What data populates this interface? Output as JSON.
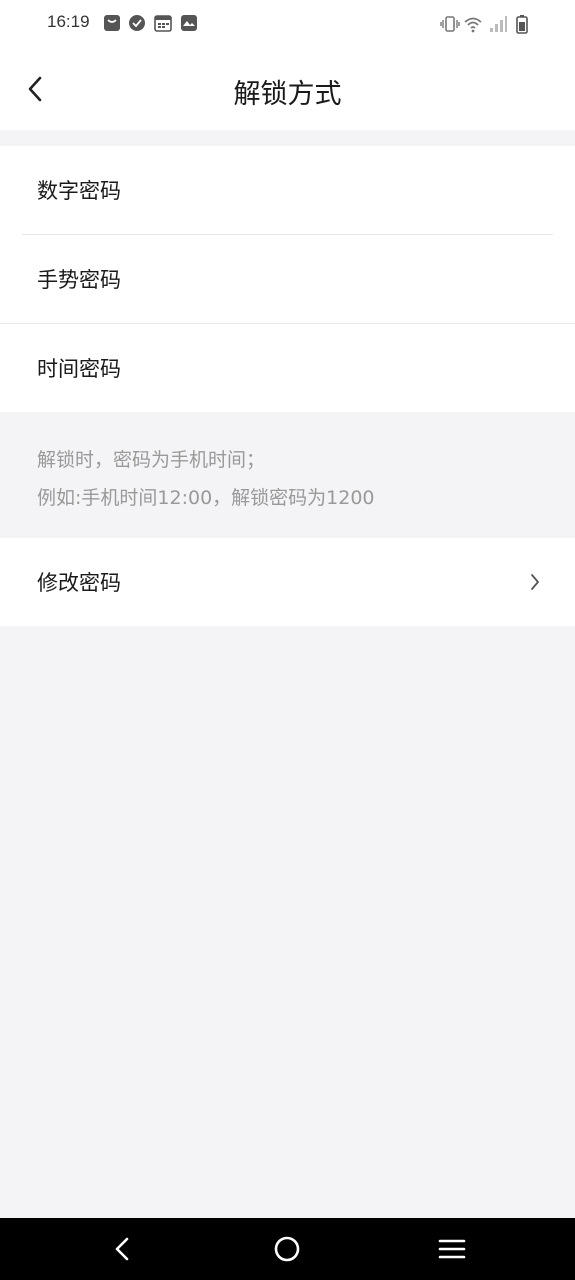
{
  "status_bar": {
    "time": "16:19",
    "notification_icons": [
      "bag-icon",
      "check-circle-icon",
      "calendar-icon",
      "photo-icon"
    ],
    "system_icons": [
      "vibrate-icon",
      "wifi-icon",
      "signal-icon",
      "battery-icon"
    ]
  },
  "header": {
    "title": "解锁方式",
    "back_icon": "chevron-left-icon"
  },
  "options": [
    {
      "label": "数字密码"
    },
    {
      "label": "手势密码"
    },
    {
      "label": "时间密码"
    }
  ],
  "hint": {
    "line1": "解锁时，密码为手机时间；",
    "line2": "例如:手机时间12:00，解锁密码为1200"
  },
  "change_password": {
    "label": "修改密码",
    "icon": "chevron-right-icon"
  },
  "nav_bar": {
    "buttons": [
      "back-triangle-icon",
      "home-circle-icon",
      "menu-lines-icon"
    ]
  },
  "colors": {
    "background": "#f4f4f6",
    "card": "#ffffff",
    "text": "#1a1a1a",
    "hint_text": "#999999",
    "nav_bar": "#000000"
  }
}
